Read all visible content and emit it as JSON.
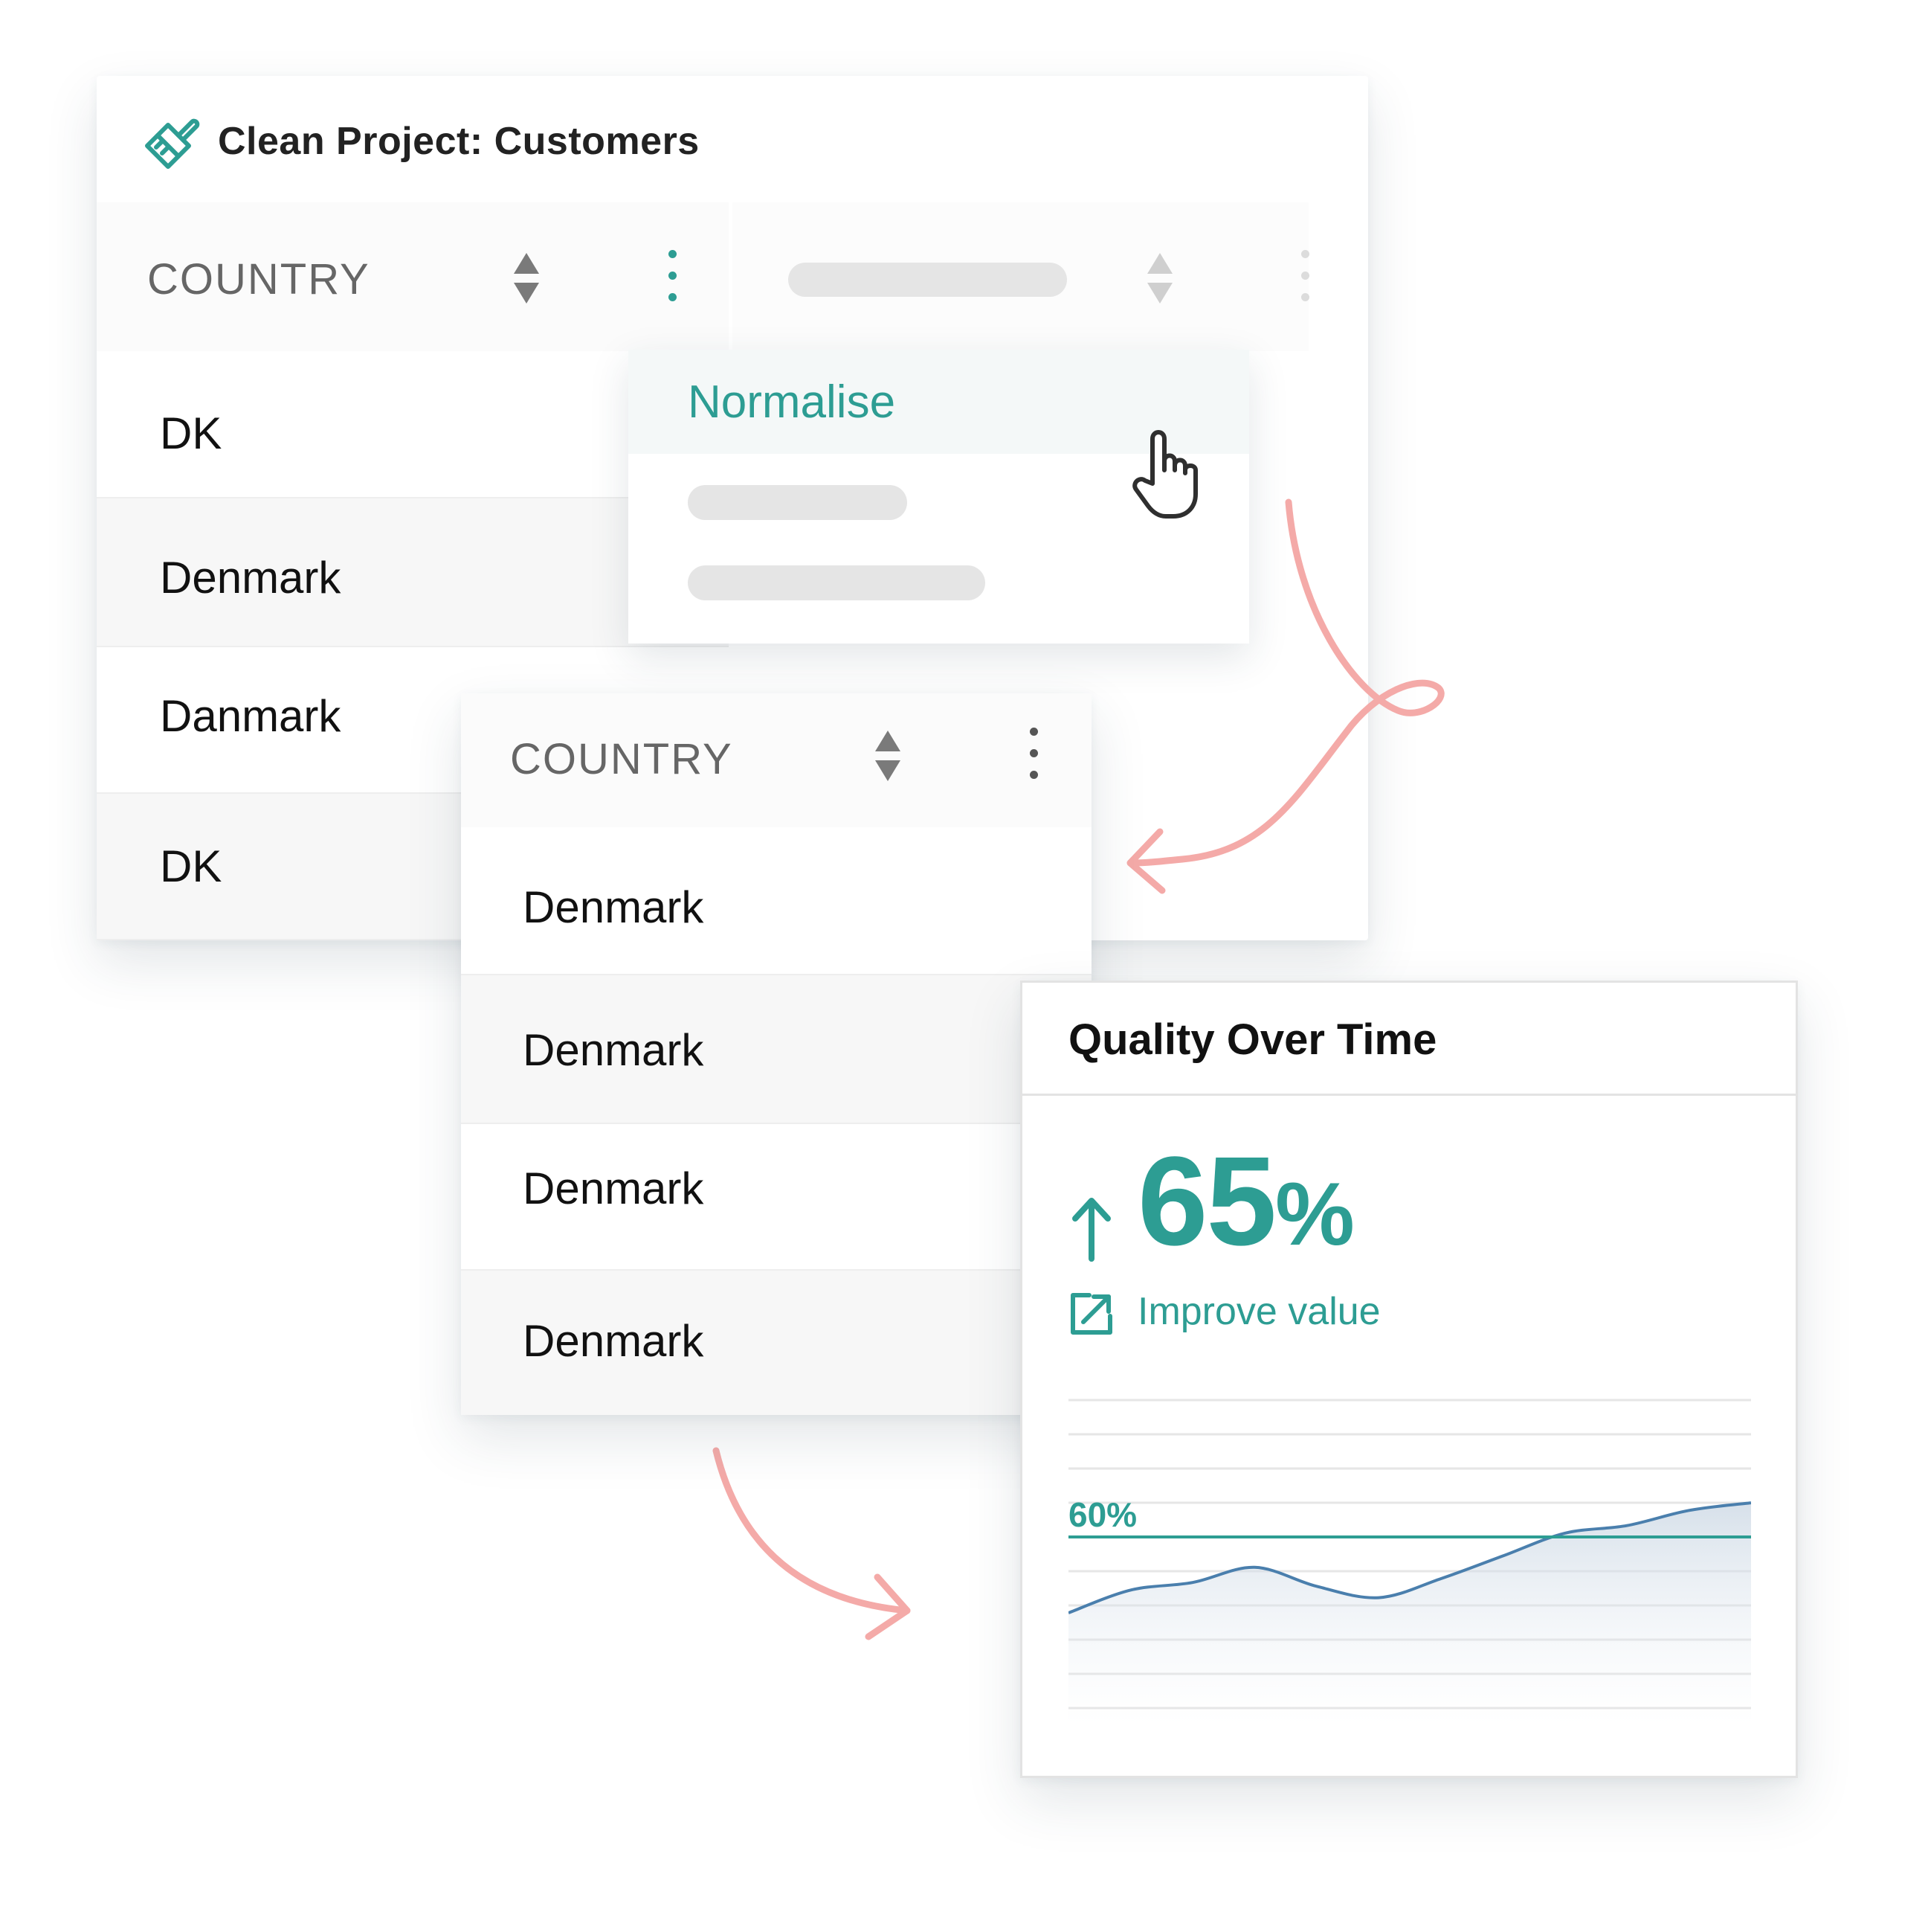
{
  "project": {
    "title": "Clean Project: Customers"
  },
  "table_before": {
    "column_header": "COUNTRY",
    "rows": [
      "DK",
      "Denmark",
      "Danmark",
      "DK"
    ]
  },
  "menu": {
    "items": [
      {
        "label": "Normalise"
      }
    ]
  },
  "table_after": {
    "column_header": "COUNTRY",
    "rows": [
      "Denmark",
      "Denmark",
      "Denmark",
      "Denmark"
    ]
  },
  "quality": {
    "title": "Quality Over Time",
    "value": "65",
    "value_unit": "%",
    "link_label": "Improve value",
    "threshold_label": "60%"
  },
  "colors": {
    "teal": "#2d9d93",
    "coral_arrow": "#f4aaa8",
    "line": "#4a7fad"
  },
  "chart_data": {
    "type": "area",
    "threshold": 60,
    "values": [
      40,
      46,
      48,
      52,
      47,
      44,
      49,
      55,
      61,
      63,
      67,
      69
    ]
  }
}
